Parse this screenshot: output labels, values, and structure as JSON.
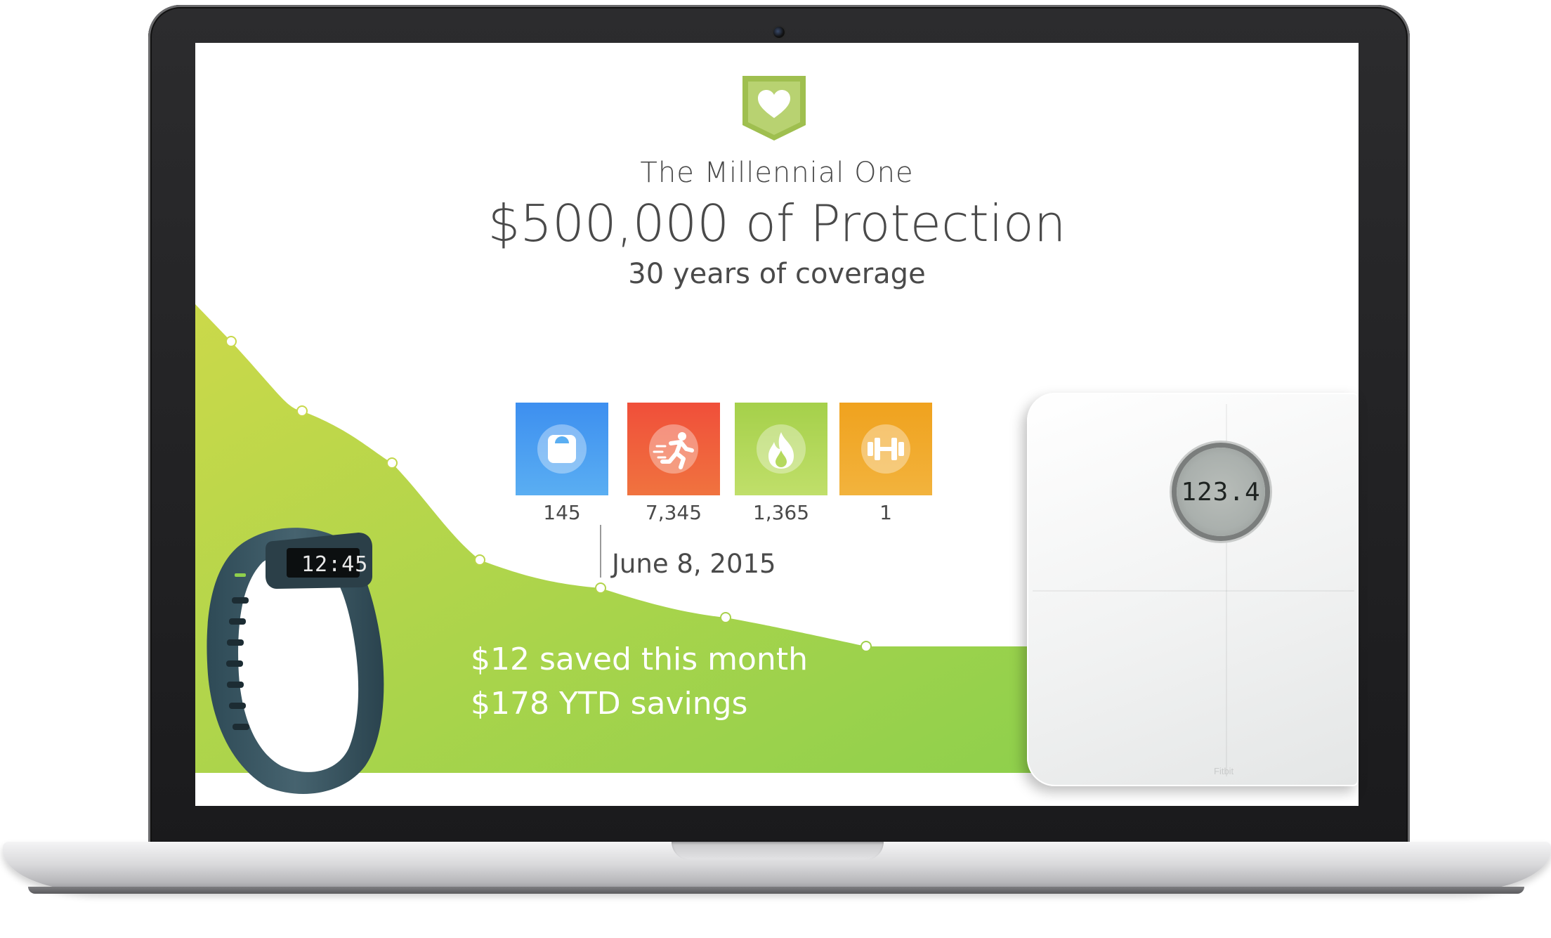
{
  "plan": {
    "tagline": "The Millennial One",
    "coverage_amount": "$500,000 of Protection",
    "term": "30 years of coverage"
  },
  "metrics": [
    {
      "icon": "scale-icon",
      "value": "145",
      "color": "#4a9ff0"
    },
    {
      "icon": "running-icon",
      "value": "7,345",
      "color": "#f1583b"
    },
    {
      "icon": "flame-icon",
      "value": "1,365",
      "color": "#a8d24e"
    },
    {
      "icon": "dumbbell-icon",
      "value": "1",
      "color": "#f0a324"
    }
  ],
  "timeline": {
    "date": "June 8, 2015"
  },
  "savings": {
    "monthly": "$12 saved this month",
    "ytd": "$178 YTD savings"
  },
  "devices": {
    "tracker_time": "12:45",
    "scale_reading": "123.4",
    "scale_brand": "Fitbit"
  },
  "colors": {
    "chart_green_light": "#c4d93e",
    "chart_green_dark": "#8fce4a",
    "text_gray": "#4a4a4a",
    "shield_green": "#9fbf4f"
  }
}
